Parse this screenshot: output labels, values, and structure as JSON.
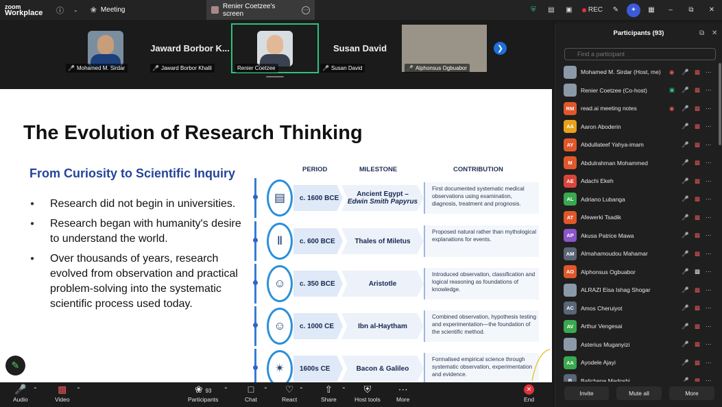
{
  "topbar": {
    "logo_line1": "zoom",
    "logo_line2": "Workplace",
    "meeting_label": "Meeting",
    "screen_tab_label": "Renier Coetzee's screen",
    "rec_label": "REC"
  },
  "tiles": [
    {
      "name": "Mohamed M. Sirdar",
      "type": "photo"
    },
    {
      "name": "Jaward Borbor Khalil",
      "type": "name",
      "display": "Jaward Borbor K..."
    },
    {
      "name": "Renier Coetzee",
      "type": "photo",
      "active": true
    },
    {
      "name": "Susan David",
      "type": "name",
      "display": "Susan David"
    },
    {
      "name": "Alphonsus Ogbuabor",
      "type": "photo"
    }
  ],
  "slide": {
    "title": "The Evolution of Research Thinking",
    "subtitle": "From Curiosity to Scientific Inquiry",
    "bullets": [
      "Research did not begin in universities.",
      "Research began with humanity's desire to understand the world.",
      "Over thousands of years, research evolved from observation and practical problem-solving into the systematic scientific process used today."
    ],
    "headers": {
      "period": "PERIOD",
      "milestone": "MILESTONE",
      "contribution": "CONTRIBUTION"
    },
    "rows": [
      {
        "icon": "tablet-icon",
        "glyph": "▤",
        "period": "c. 1600 BCE",
        "milestone": "Ancient Egypt –",
        "milestone_sub": "Edwin Smith Papyrus",
        "contribution": "First documented systematic medical observations using examination, diagnosis, treatment and prognosis."
      },
      {
        "icon": "column-icon",
        "glyph": "Ⅱ",
        "period": "c. 600 BCE",
        "milestone": "Thales of Miletus",
        "milestone_sub": "",
        "contribution": "Proposed natural rather than mythological explanations for events."
      },
      {
        "icon": "philosopher-icon",
        "glyph": "☺",
        "period": "c. 350 BCE",
        "milestone": "Aristotle",
        "milestone_sub": "",
        "contribution": "Introduced observation, classification and logical reasoning as foundations of knowledge."
      },
      {
        "icon": "scholar-icon",
        "glyph": "☺",
        "period": "c. 1000 CE",
        "milestone": "Ibn al-Haytham",
        "milestone_sub": "",
        "contribution": "Combined observation, hypothesis testing and experimentation—the foundation of the scientific method."
      },
      {
        "icon": "telescope-icon",
        "glyph": "✴",
        "period": "1600s CE",
        "milestone": "Bacon & Galileo",
        "milestone_sub": "",
        "contribution": "Formalised empirical science through systematic observation, experimentation and evidence."
      }
    ]
  },
  "bottombar": {
    "audio": "Audio",
    "video": "Video",
    "participants": "Participants",
    "participants_count": "93",
    "chat": "Chat",
    "react": "React",
    "share": "Share",
    "host_tools": "Host tools",
    "more": "More",
    "end": "End"
  },
  "panel": {
    "title": "Participants (93)",
    "search_placeholder": "Find a participant",
    "invite": "Invite",
    "mute_all": "Mute all",
    "more": "More",
    "participants": [
      {
        "name": "Mohamed M. Sirdar (Host, me)",
        "initials": "",
        "color": "",
        "photo": true,
        "rec": true,
        "mic": "off",
        "cam": "off"
      },
      {
        "name": "Renier Coetzee (Co-host)",
        "initials": "",
        "color": "",
        "photo": true,
        "share": true,
        "mic": "on",
        "cam": "off"
      },
      {
        "name": "read.ai meeting notes",
        "initials": "RM",
        "color": "#e0572b",
        "rec": true,
        "mic": "on",
        "cam": "off"
      },
      {
        "name": "Aaron Aboderin",
        "initials": "AA",
        "color": "#e8a21a",
        "mic": "off",
        "cam": "off"
      },
      {
        "name": "Abdullateef Yahya-imam",
        "initials": "AY",
        "color": "#e0572b",
        "mic": "off",
        "cam": "off"
      },
      {
        "name": "Abdulrahman Mohammed",
        "initials": "M",
        "color": "#e0572b",
        "mic": "off",
        "cam": "off"
      },
      {
        "name": "Adachi Ekeh",
        "initials": "AE",
        "color": "#d9453a",
        "mic": "off",
        "cam": "off"
      },
      {
        "name": "Adriano Lubanga",
        "initials": "AL",
        "color": "#3aa84f",
        "mic": "off",
        "cam": "off"
      },
      {
        "name": "Afewerki Tsadik",
        "initials": "AT",
        "color": "#e0572b",
        "mic": "off",
        "cam": "off"
      },
      {
        "name": "Akusa Patrice Mawa",
        "initials": "AP",
        "color": "#8a56c9",
        "mic": "off",
        "cam": "off"
      },
      {
        "name": "Almahamoudou Mahamar",
        "initials": "AM",
        "color": "#5a6677",
        "mic": "off",
        "cam": "off"
      },
      {
        "name": "Alphonsus Ogbuabor",
        "initials": "AO",
        "color": "#e0572b",
        "mic": "off",
        "cam": "on"
      },
      {
        "name": "ALRAZI Eisa Ishag Shogar",
        "initials": "",
        "color": "",
        "photo": true,
        "mic": "off",
        "cam": "off"
      },
      {
        "name": "Amos Cheruiyot",
        "initials": "AC",
        "color": "#5a6677",
        "mic": "off",
        "cam": "off"
      },
      {
        "name": "Arthur Vengesai",
        "initials": "AV",
        "color": "#3aa84f",
        "mic": "off",
        "cam": "off"
      },
      {
        "name": "Asterius Muganyizi",
        "initials": "",
        "color": "",
        "photo": true,
        "mic": "off",
        "cam": "off"
      },
      {
        "name": "Ayodele Ajayi",
        "initials": "AA",
        "color": "#3aa84f",
        "mic": "off",
        "cam": "off"
      },
      {
        "name": "Balichene Madoshi",
        "initials": "B",
        "color": "#5a6677",
        "mic": "off",
        "cam": "off"
      }
    ]
  }
}
